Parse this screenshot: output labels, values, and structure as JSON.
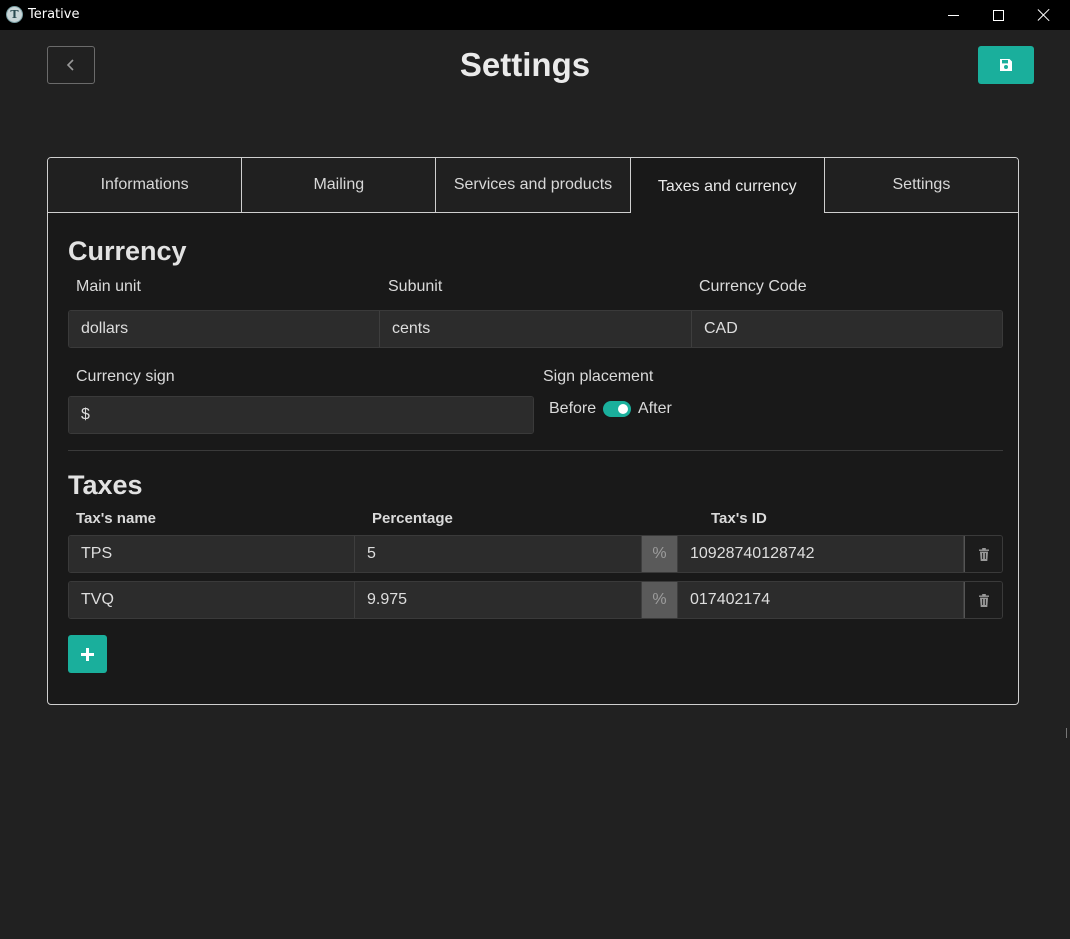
{
  "window": {
    "app_title": "Terative",
    "app_icon_letter": "T"
  },
  "header": {
    "title": "Settings",
    "back_icon": "chevron-left-icon",
    "save_icon": "floppy-disk-icon"
  },
  "tabs": [
    {
      "label": "Informations",
      "active": false
    },
    {
      "label": "Mailing",
      "active": false
    },
    {
      "label": "Services and products",
      "active": false
    },
    {
      "label": "Taxes and currency",
      "active": true
    },
    {
      "label": "Settings",
      "active": false
    }
  ],
  "currency": {
    "title": "Currency",
    "main_unit_label": "Main unit",
    "main_unit_value": "dollars",
    "subunit_label": "Subunit",
    "subunit_value": "cents",
    "code_label": "Currency Code",
    "code_value": "CAD",
    "sign_label": "Currency sign",
    "sign_value": "$",
    "placement_label": "Sign placement",
    "placement_before": "Before",
    "placement_after": "After",
    "placement_after_selected": true
  },
  "taxes": {
    "title": "Taxes",
    "col_name": "Tax's name",
    "col_percentage": "Percentage",
    "col_id": "Tax's ID",
    "percent_symbol": "%",
    "rows": [
      {
        "name": "TPS",
        "percentage": "5",
        "tax_id": "10928740128742"
      },
      {
        "name": "TVQ",
        "percentage": "9.975",
        "tax_id": "017402174"
      }
    ],
    "add_icon": "plus-icon",
    "delete_icon": "trash-icon"
  },
  "colors": {
    "accent": "#1aaf9c",
    "background": "#212121",
    "card": "#191919",
    "input": "#2c2c2c"
  }
}
